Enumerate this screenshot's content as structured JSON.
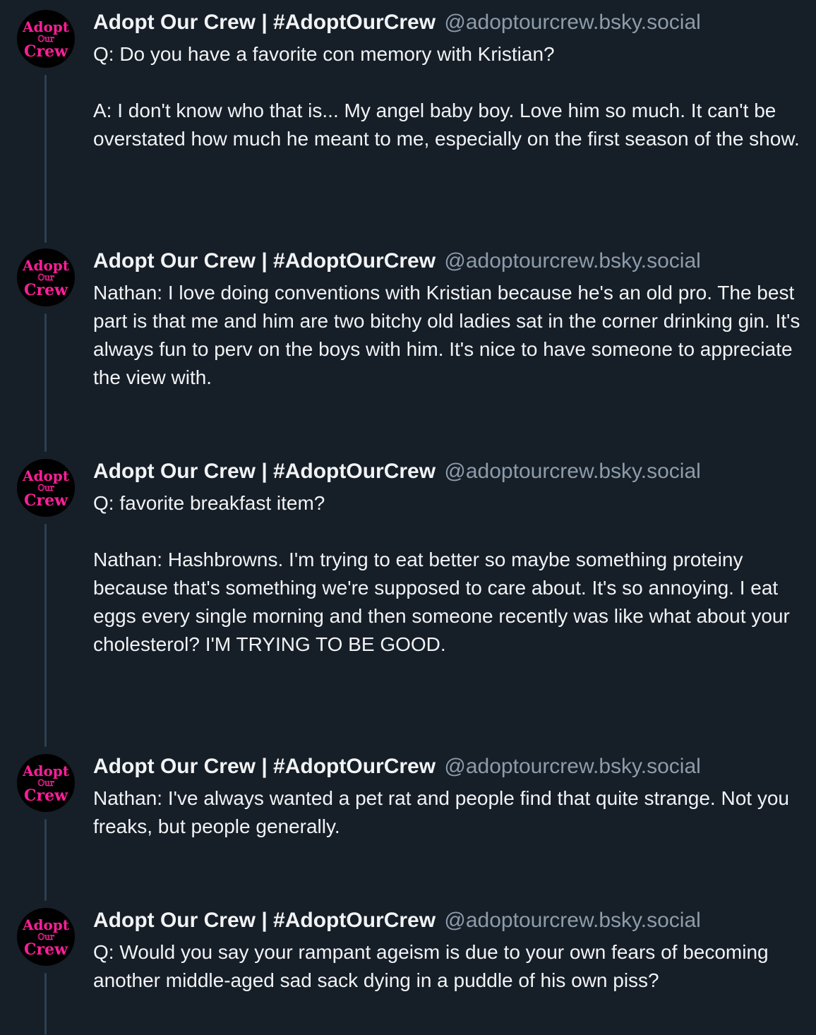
{
  "colors": {
    "background": "#161e27",
    "text": "#f1f3f5",
    "handle": "#8d9cab",
    "thread_line": "#2e4052",
    "avatar_accent": "#ff1f9a"
  },
  "avatar": {
    "icon": "adopt-our-crew-logo",
    "line1": "Adopt",
    "line2": "Our",
    "line3": "Crew"
  },
  "posts": [
    {
      "display_name": "Adopt Our Crew | #AdoptOurCrew",
      "handle": "@adoptourcrew.bsky.social",
      "text": "Q: Do you have a favorite con memory with Kristian?\n\nA: I don't know who that is... My angel baby boy. Love him so much. It can't be overstated how much he meant to me, especially on the first season of the show."
    },
    {
      "display_name": "Adopt Our Crew | #AdoptOurCrew",
      "handle": "@adoptourcrew.bsky.social",
      "text": "Nathan: I love doing conventions with Kristian because he's an old pro. The best part is that me and him are two bitchy old ladies sat in the corner drinking gin. It's always fun to perv on the boys with him. It's nice to have someone to appreciate the view with."
    },
    {
      "display_name": "Adopt Our Crew | #AdoptOurCrew",
      "handle": "@adoptourcrew.bsky.social",
      "text": "Q: favorite breakfast item?\n\nNathan: Hashbrowns. I'm trying to eat better so maybe something proteiny because that's something we're supposed to care about. It's so annoying. I eat eggs every single morning and then someone recently was like what about your cholesterol? I'M TRYING TO BE GOOD."
    },
    {
      "display_name": "Adopt Our Crew | #AdoptOurCrew",
      "handle": "@adoptourcrew.bsky.social",
      "text": "Nathan: I've always wanted a pet rat and people find that quite strange. Not you freaks, but people generally."
    },
    {
      "display_name": "Adopt Our Crew | #AdoptOurCrew",
      "handle": "@adoptourcrew.bsky.social",
      "text": "Q: Would you say your rampant ageism is due to your own fears of becoming another middle-aged sad sack dying in a puddle of his own piss?"
    }
  ]
}
